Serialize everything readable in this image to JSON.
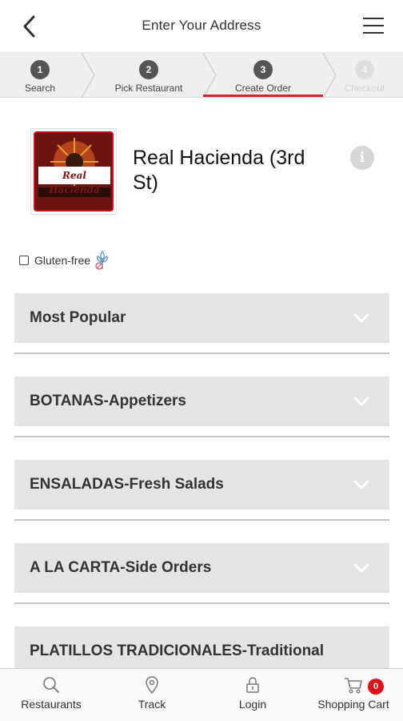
{
  "header": {
    "title": "Enter Your Address"
  },
  "steps": [
    {
      "number": "1",
      "label": "Search"
    },
    {
      "number": "2",
      "label": "Pick Restaurant"
    },
    {
      "number": "3",
      "label": "Create Order"
    },
    {
      "number": "4",
      "label": "Checkout"
    }
  ],
  "restaurant": {
    "name": "Real Hacienda (3rd St)",
    "logo_text": "Real Hacienda",
    "info_symbol": "i"
  },
  "filters": {
    "gluten_free_label": "Gluten-free",
    "gluten_free_checked": false
  },
  "categories": [
    {
      "label": "Most Popular"
    },
    {
      "label": "BOTANAS-Appetizers"
    },
    {
      "label": "ENSALADAS-Fresh Salads"
    },
    {
      "label": "A LA CARTA-Side Orders"
    },
    {
      "label": "PLATILLOS TRADICIONALES-Traditional"
    }
  ],
  "bottom_nav": {
    "items": [
      {
        "label": "Restaurants",
        "icon": "search-icon"
      },
      {
        "label": "Track",
        "icon": "location-pin-icon"
      },
      {
        "label": "Login",
        "icon": "lock-icon"
      },
      {
        "label": "Shopping Cart",
        "icon": "cart-icon"
      }
    ],
    "cart_count": "0"
  },
  "colors": {
    "accent": "#d22630",
    "badge": "#e0101a",
    "category_bg": "#e4e4e4",
    "step_bar_bg": "#eeeeee"
  }
}
